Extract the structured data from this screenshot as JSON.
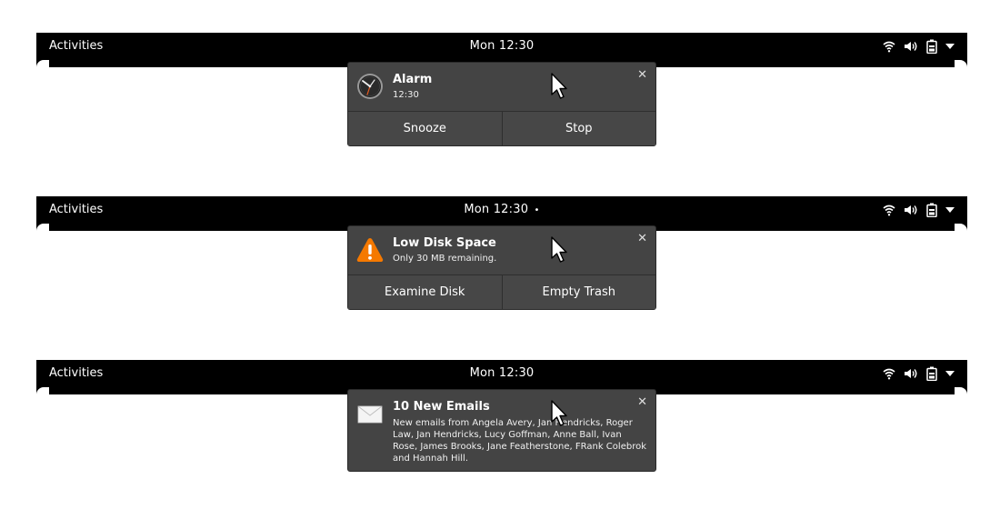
{
  "scenes": [
    {
      "topbar": {
        "activities": "Activities",
        "clock": "Mon 12:30",
        "dot": ""
      },
      "notification": {
        "title": "Alarm",
        "body": "12:30",
        "icon": "alarm-clock-icon",
        "actions": [
          "Snooze",
          "Stop"
        ]
      }
    },
    {
      "topbar": {
        "activities": "Activities",
        "clock": "Mon 12:30",
        "dot": "•"
      },
      "notification": {
        "title": "Low Disk Space",
        "body": "Only 30 MB remaining.",
        "icon": "warning-icon",
        "actions": [
          "Examine Disk",
          "Empty Trash"
        ]
      }
    },
    {
      "topbar": {
        "activities": "Activities",
        "clock": "Mon 12:30",
        "dot": ""
      },
      "notification": {
        "title": "10 New Emails",
        "body": "New emails from Angela Avery, Jan Hendricks, Roger Law, Jan Hendricks, Lucy Goffman, Anne Ball, Ivan Rose, James Brooks, Jane Featherstone, FRank Colebrok and Hannah Hill.",
        "icon": "envelope-icon",
        "actions": []
      }
    }
  ],
  "tray_icons": [
    "wifi-icon",
    "volume-icon",
    "battery-icon",
    "menu-dropdown-icon"
  ],
  "colors": {
    "bar": "#000000",
    "notification_bg": "#444444",
    "warning": "#f57900"
  }
}
